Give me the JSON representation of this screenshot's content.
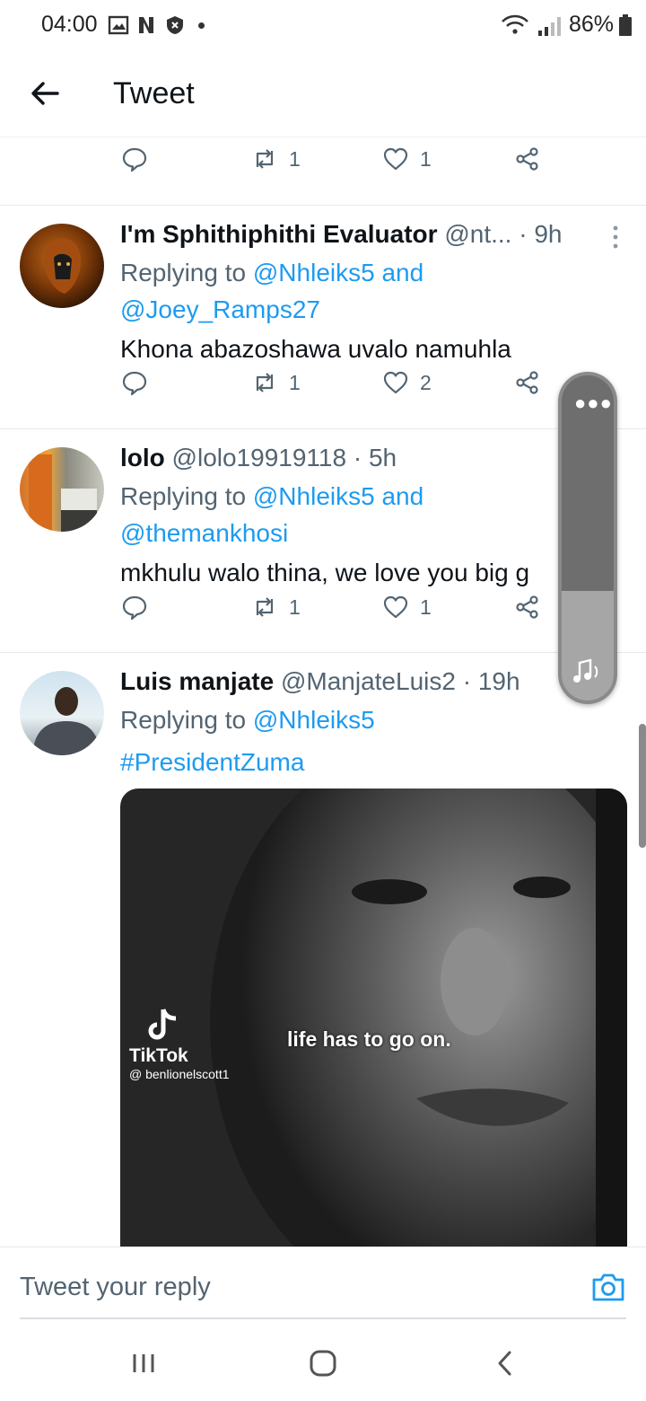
{
  "status": {
    "time": "04:00",
    "battery": "86%"
  },
  "header": {
    "title": "Tweet"
  },
  "first_actions": {
    "retweets": "1",
    "likes": "1"
  },
  "tweets": [
    {
      "name": "I'm Sphithiphithi Evaluator",
      "handle": "@nt...",
      "time": "· 9h",
      "replying_prefix": "Replying to",
      "replying_line1": "@Nhleiks5 and",
      "replying_line2": "@Joey_Ramps27",
      "text": "Khona abazoshawa uvalo namuhla",
      "retweets": "1",
      "likes": "2"
    },
    {
      "name": "lolo",
      "handle": "@lolo19919118",
      "time": "· 5h",
      "replying_prefix": "Replying to",
      "replying_line1": "@Nhleiks5 and",
      "replying_line2": "@themankhosi",
      "text": "mkhulu walo thina, we love you big g",
      "retweets": "1",
      "likes": "1"
    },
    {
      "name": "Luis manjate",
      "handle": "@ManjateLuis2",
      "time": "· 19h",
      "replying_prefix": "Replying to",
      "replying_line1": "@Nhleiks5",
      "hashtag": "#PresidentZuma",
      "media": {
        "caption": "life has to go on.",
        "brand": "TikTok",
        "username": "@ benlionelscott1"
      }
    }
  ],
  "reply_bar": {
    "placeholder": "Tweet your reply"
  },
  "colors": {
    "link": "#1d9bf0",
    "secondary_text": "#536471",
    "primary_text": "#0f1419"
  },
  "icons": [
    "back-arrow-icon",
    "reply-icon",
    "retweet-icon",
    "like-icon",
    "share-icon",
    "more-icon",
    "camera-icon",
    "recents-icon",
    "home-icon",
    "nav-back-icon"
  ]
}
